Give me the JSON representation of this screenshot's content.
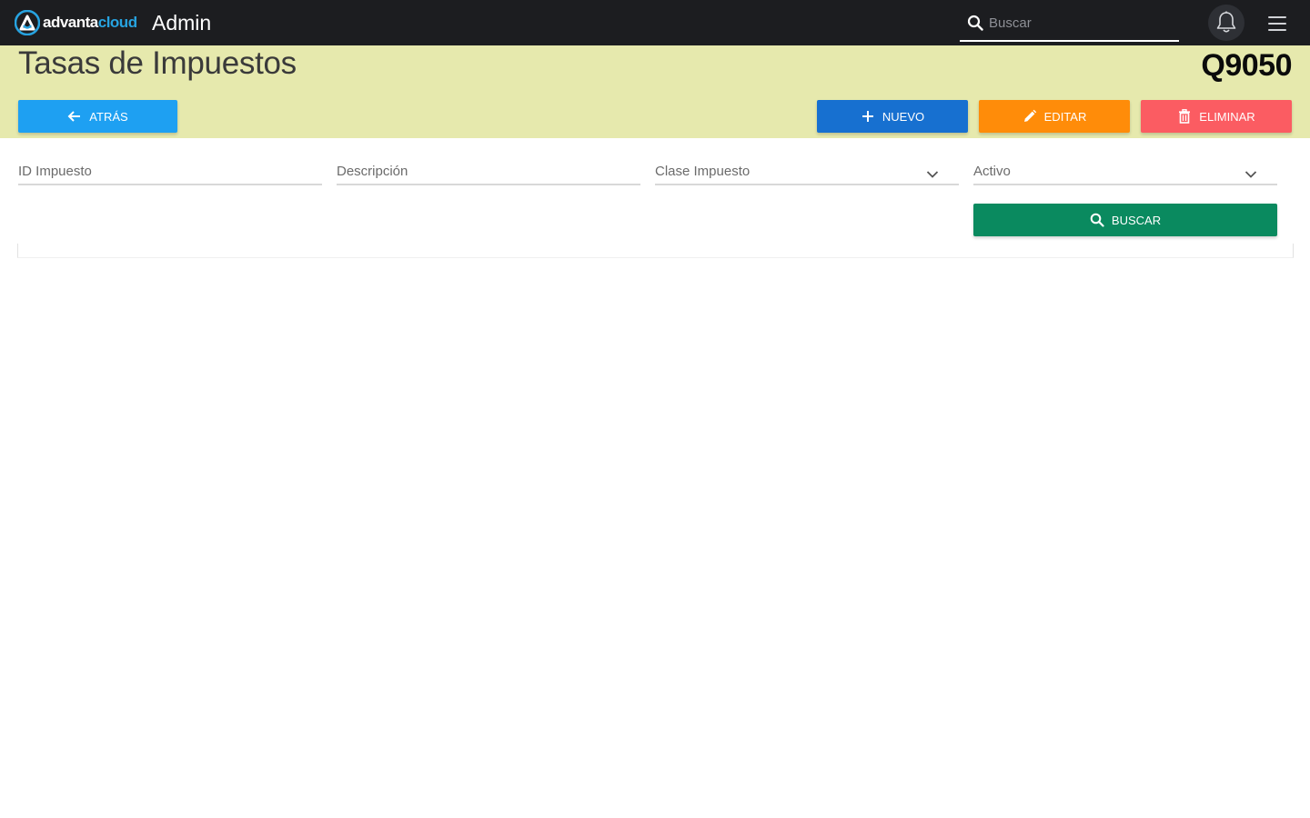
{
  "brand": {
    "logo_part1": "advanta",
    "logo_part2": "cloud",
    "logo_accent": "#27a3e0",
    "app_name": "Admin"
  },
  "topbar": {
    "search_placeholder": "Buscar",
    "bell_icon": "bell-icon",
    "menu_icon": "hamburger-icon",
    "background": "#1c1d20"
  },
  "header": {
    "title": "Tasas de Impuestos",
    "code": "Q9050",
    "background": "#e6e9ad"
  },
  "actions": {
    "back_label": "ATRÁS",
    "new_label": "NUEVO",
    "edit_label": "EDITAR",
    "delete_label": "ELIMINAR",
    "colors": {
      "back": "#1ea0f2",
      "new": "#1770d0",
      "edit": "#ff8c09",
      "delete": "#fb5c62"
    }
  },
  "filters": {
    "id_label": "ID Impuesto",
    "description_label": "Descripción",
    "class_label": "Clase Impuesto",
    "active_label": "Activo",
    "search_label": "BUSCAR",
    "search_color": "#0a8a5f"
  }
}
